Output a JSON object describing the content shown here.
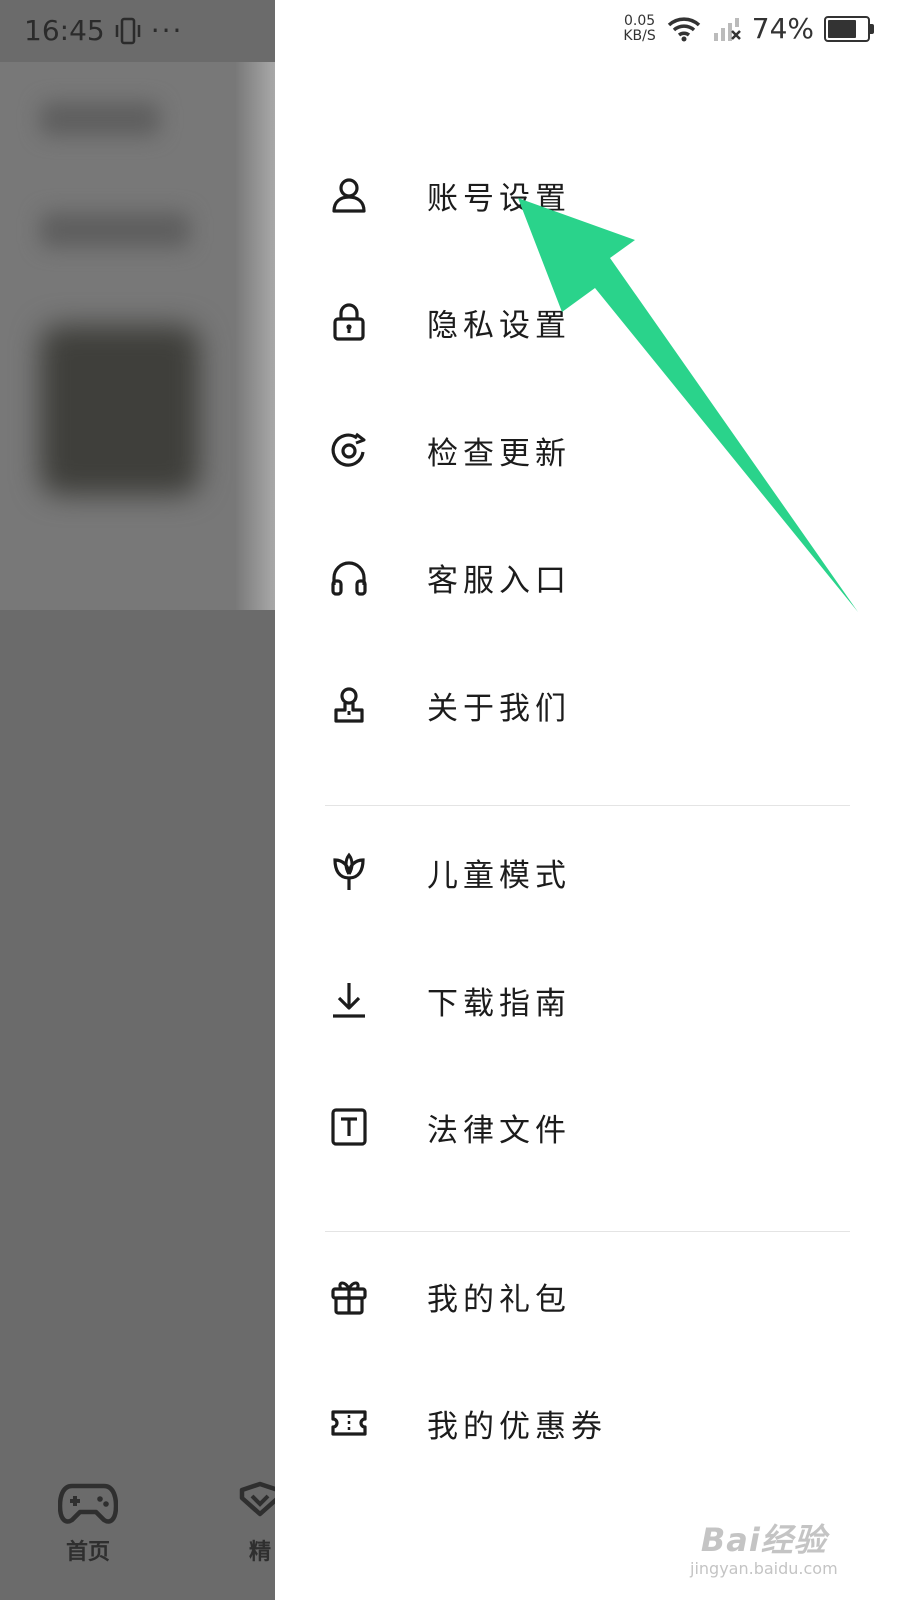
{
  "status_bar": {
    "time": "16:45",
    "more_dots": "···",
    "net_speed_value": "0.05",
    "net_speed_unit": "KB/S",
    "battery_percent": "74%",
    "battery_level": 0.74
  },
  "drawer": {
    "menu_items": [
      {
        "label": "账号设置",
        "icon": "user-icon"
      },
      {
        "label": "隐私设置",
        "icon": "lock-icon"
      },
      {
        "label": "检查更新",
        "icon": "refresh-icon"
      },
      {
        "label": "客服入口",
        "icon": "headphones-icon"
      },
      {
        "label": "关于我们",
        "icon": "person-badge-icon"
      },
      {
        "label": "儿童模式",
        "icon": "sprout-icon"
      },
      {
        "label": "下载指南",
        "icon": "download-icon"
      },
      {
        "label": "法律文件",
        "icon": "text-box-icon"
      },
      {
        "label": "我的礼包",
        "icon": "gift-icon"
      },
      {
        "label": "我的优惠券",
        "icon": "ticket-icon"
      }
    ]
  },
  "background_app": {
    "bottom_nav": [
      {
        "label": "首页",
        "icon": "gamepad-icon"
      },
      {
        "label": "精",
        "icon": "heart-icon"
      }
    ]
  },
  "annotation": {
    "arrow_color": "#2ad38b"
  },
  "watermark": {
    "logo": "Bai经验",
    "url": "jingyan.baidu.com"
  }
}
